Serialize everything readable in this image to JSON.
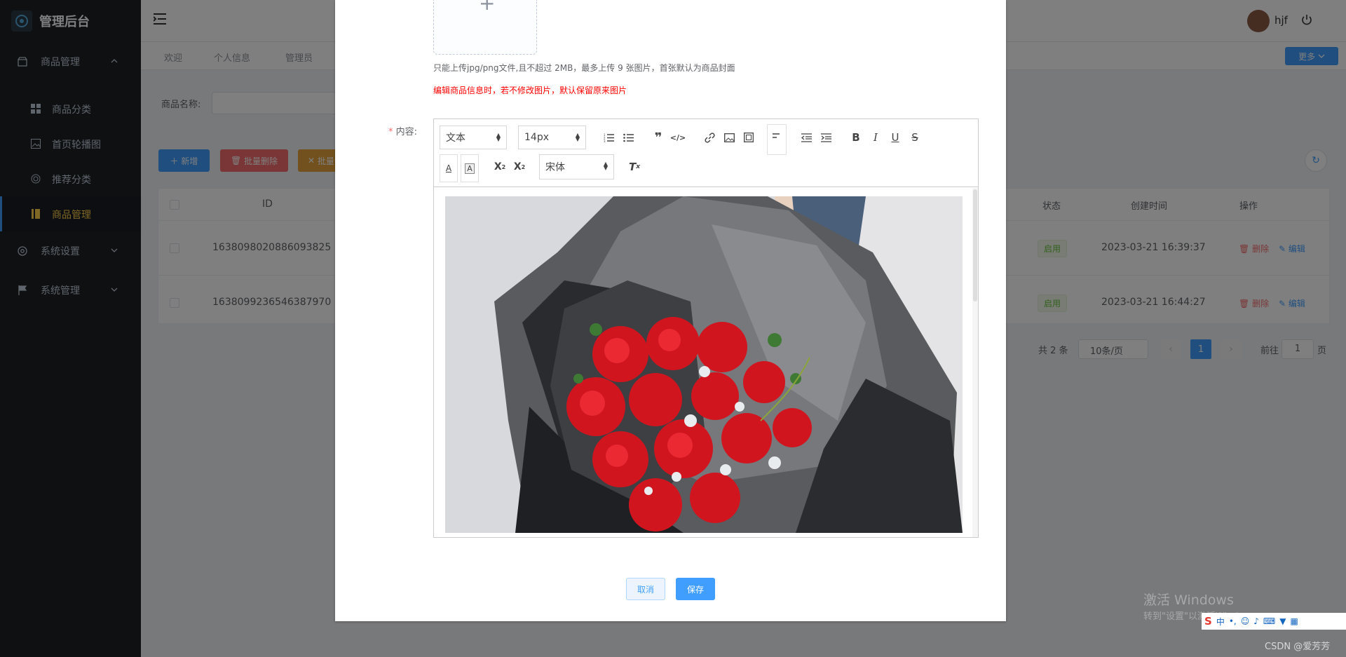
{
  "app": {
    "title": "管理后台"
  },
  "sidebar": {
    "groups": [
      {
        "label": "商品管理",
        "icon": "shop-icon"
      },
      {
        "label": "系统设置",
        "icon": "gear-icon"
      },
      {
        "label": "系统管理",
        "icon": "flag-icon"
      }
    ],
    "sub_items": [
      {
        "label": "商品分类",
        "icon": "grid-icon"
      },
      {
        "label": "首页轮播图",
        "icon": "image-icon"
      },
      {
        "label": "推荐分类",
        "icon": "target-icon"
      },
      {
        "label": "商品管理",
        "icon": "book-icon",
        "active": true
      }
    ]
  },
  "header": {
    "username": "hjf",
    "more_label": "更多"
  },
  "tabs": [
    "欢迎",
    "个人信息",
    "管理员"
  ],
  "search": {
    "label": "商品名称:"
  },
  "actions": {
    "add": "新增",
    "batch_delete": "批量删除",
    "batch_other": "批量"
  },
  "table": {
    "columns": {
      "id": "ID",
      "status": "状态",
      "created": "创建时间",
      "ops": "操作"
    },
    "rows": [
      {
        "id": "1638098020886093825",
        "status": "启用",
        "created": "2023-03-21 16:39:37",
        "delete": "删除",
        "edit": "编辑"
      },
      {
        "id": "1638099236546387970",
        "status": "启用",
        "created": "2023-03-21 16:44:27",
        "delete": "删除",
        "edit": "编辑"
      }
    ]
  },
  "pagination": {
    "total": "共 2 条",
    "page_size": "10条/页",
    "current": "1",
    "goto_prefix": "前往",
    "goto_value": "1",
    "goto_suffix": "页"
  },
  "dialog": {
    "upload_hint": "只能上传jpg/png文件,且不超过 2MB，最多上传 9 张图片，首张默认为商品封面",
    "edit_hint": "编辑商品信息时，若不修改图片，默认保留原来图片",
    "content_label": "内容:",
    "required_mark": "*",
    "editor": {
      "block_format": "文本",
      "font_size": "14px",
      "font_family": "宋体"
    },
    "cancel": "取消",
    "save": "保存"
  },
  "watermark": {
    "line1": "激活 Windows",
    "line2": "转到\"设置\"以激活Windows。",
    "csdn": "CSDN @爱芳芳"
  },
  "colors": {
    "primary": "#409eff",
    "danger": "#f56c6c",
    "warning": "#e6a23c",
    "sidebar": "#1d2025",
    "active_text": "#ffd04b",
    "hint_red": "#ff0000"
  }
}
